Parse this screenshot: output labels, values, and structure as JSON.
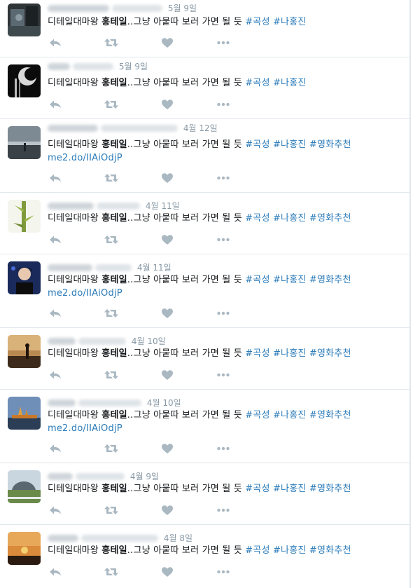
{
  "colors": {
    "text": "#14171a",
    "meta": "#8899a6",
    "link": "#2b7bb9",
    "icon": "#aab8c2",
    "divider": "#e1e8ed"
  },
  "icons": {
    "reply": "reply-icon",
    "retweet": "retweet-icon",
    "like": "heart-icon",
    "more": "more-icon"
  },
  "tweets": [
    {
      "date": "5월 9일",
      "text_prefix": "디테일대마왕 ",
      "text_bold": "홍테일",
      "text_rest": "..그냥 아뭍따 보러 가면 될 듯 ",
      "hashtags": [
        "#곡성",
        "#나홍진"
      ],
      "link": ""
    },
    {
      "date": "5월 9일",
      "text_prefix": "디테일대마왕 ",
      "text_bold": "홍테일",
      "text_rest": "..그냥 아뭍따 보러 가면 될 듯 ",
      "hashtags": [
        "#곡성",
        "#나홍진"
      ],
      "link": ""
    },
    {
      "date": "4월 12일",
      "text_prefix": "디테일대마왕 ",
      "text_bold": "홍테일",
      "text_rest": "..그냥 아뭍따 보러 가면 될 듯 ",
      "hashtags": [
        "#곡성",
        "#나홍진",
        "#영화추천"
      ],
      "link": "me2.do/IIAiOdjP"
    },
    {
      "date": "4월 11일",
      "text_prefix": "디테일대마왕 ",
      "text_bold": "홍테일",
      "text_rest": "..그냥 아뭍따 보러 가면 될 듯 ",
      "hashtags": [
        "#곡성",
        "#나홍진",
        "#영화추천"
      ],
      "link": ""
    },
    {
      "date": "4월 11일",
      "text_prefix": "디테일대마왕 ",
      "text_bold": "홍테일",
      "text_rest": "..그냥 아뭍따 보러 가면 될 듯 ",
      "hashtags": [
        "#곡성",
        "#나홍진",
        "#영화추천"
      ],
      "link": "me2.do/IIAiOdjP"
    },
    {
      "date": "4월 10일",
      "text_prefix": "디테일대마왕 ",
      "text_bold": "홍테일",
      "text_rest": "..그냥 아뭍따 보러 가면 될 듯 ",
      "hashtags": [
        "#곡성",
        "#나홍진",
        "#영화추천"
      ],
      "link": ""
    },
    {
      "date": "4월 10일",
      "text_prefix": "디테일대마왕 ",
      "text_bold": "홍테일",
      "text_rest": "..그냥 아뭍따 보러 가면 될 듯 ",
      "hashtags": [
        "#곡성",
        "#나홍진",
        "#영화추천"
      ],
      "link": "me2.do/IIAiOdjP"
    },
    {
      "date": "4월 9일",
      "text_prefix": "디테일대마왕 ",
      "text_bold": "홍테일",
      "text_rest": "..그냥 아뭍따 보러 가면 될 듯 ",
      "hashtags": [
        "#곡성",
        "#나홍진",
        "#영화추천"
      ],
      "link": ""
    },
    {
      "date": "4월 8일",
      "text_prefix": "디테일대마왕 ",
      "text_bold": "홍테일",
      "text_rest": "..그냥 아뭍따 보러 가면 될 듯 ",
      "hashtags": [
        "#곡성",
        "#나홍진",
        "#영화추천"
      ],
      "link": ""
    }
  ]
}
